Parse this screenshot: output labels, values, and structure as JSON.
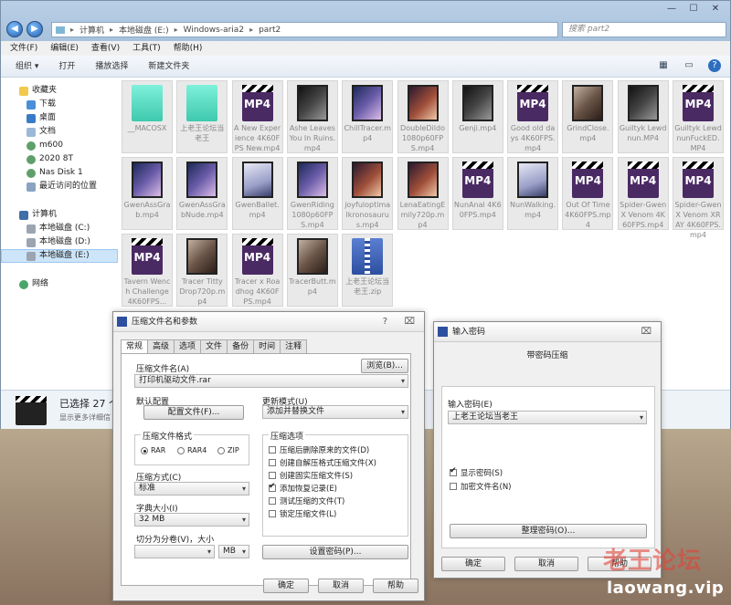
{
  "explorer": {
    "breadcrumb": [
      "计算机",
      "本地磁盘 (E:)",
      "Windows-aria2",
      "part2"
    ],
    "search_placeholder": "搜索 part2",
    "menu": [
      "文件(F)",
      "编辑(E)",
      "查看(V)",
      "工具(T)",
      "帮助(H)"
    ],
    "toolbar": [
      "组织 ▾",
      "打开",
      "播放选择",
      "新建文件夹"
    ],
    "sidebar": {
      "favorites_header": "收藏夹",
      "favorites": [
        "下载",
        "桌面",
        "文档",
        "m600",
        "2020 8T",
        "Nas Disk 1",
        "最近访问的位置"
      ],
      "computer_header": "计算机",
      "drives": [
        "本地磁盘 (C:)",
        "本地磁盘 (D:)",
        "本地磁盘 (E:)"
      ],
      "network": "网络"
    },
    "files": [
      {
        "name": "__MACOSX",
        "type": "folder"
      },
      {
        "name": "上老王论坛当老王",
        "type": "folder"
      },
      {
        "name": "A New Experience 4K60FPS New.mp4",
        "type": "mp4"
      },
      {
        "name": "Ashe Leaves You In Ruins.mp4",
        "type": "thumb",
        "v": "c"
      },
      {
        "name": "ChillTracer.mp4",
        "type": "thumb",
        "v": "b"
      },
      {
        "name": "DoubleDildo1080p60FPS.mp4",
        "type": "thumb",
        "v": "a"
      },
      {
        "name": "Genji.mp4",
        "type": "thumb",
        "v": "c"
      },
      {
        "name": "Good old days 4K60FPS.mp4",
        "type": "mp4"
      },
      {
        "name": "GrindClose.mp4",
        "type": "thumb",
        "v": "d"
      },
      {
        "name": "Guiltyk Lewd nun.MP4",
        "type": "thumb",
        "v": "c"
      },
      {
        "name": "Guiltyk Lewd nunFuckED.MP4",
        "type": "mp4"
      },
      {
        "name": "GwenAssGrab.mp4",
        "type": "thumb",
        "v": "b"
      },
      {
        "name": "GwenAssGrabNude.mp4",
        "type": "thumb",
        "v": "b"
      },
      {
        "name": "GwenBallet.mp4",
        "type": "thumb",
        "v": "e"
      },
      {
        "name": "GwenRiding1080p60FPS.mp4",
        "type": "thumb",
        "v": "b"
      },
      {
        "name": "joyfuloptimalkronosaurus.mp4",
        "type": "thumb",
        "v": "a"
      },
      {
        "name": "LenaEatingEmily720p.mp4",
        "type": "thumb",
        "v": "a"
      },
      {
        "name": "NunAnal 4K60FPS.mp4",
        "type": "mp4"
      },
      {
        "name": "NunWalking.mp4",
        "type": "thumb",
        "v": "e"
      },
      {
        "name": "Out Of Time 4K60FPS.mp4",
        "type": "mp4"
      },
      {
        "name": "Spider-Gwen X Venom 4K60FPS.mp4",
        "type": "mp4"
      },
      {
        "name": "Spider-Gwen X Venom XRAY 4K60FPS.mp4",
        "type": "mp4"
      },
      {
        "name": "Tavern Wench Challenge 4K60FPS...",
        "type": "mp4"
      },
      {
        "name": "Tracer Titty Drop720p.mp4",
        "type": "thumb",
        "v": "d"
      },
      {
        "name": "Tracer x Roadhog 4K60FPS.mp4",
        "type": "mp4"
      },
      {
        "name": "TracerButt.mp4",
        "type": "thumb",
        "v": "d"
      },
      {
        "name": "上老王论坛当老王.zip",
        "type": "zip"
      }
    ],
    "mp4_label": "MP4",
    "status_selected": "已选择 27 个",
    "status_detail": "显示更多详细信"
  },
  "archive_dialog": {
    "title": "压缩文件名和参数",
    "title_controls": [
      "?",
      "⌧"
    ],
    "tabs": [
      "常规",
      "高级",
      "选项",
      "文件",
      "备份",
      "时间",
      "注释"
    ],
    "filename_label": "压缩文件名(A)",
    "browse_button": "浏览(B)...",
    "filename_value": "打印机驱动文件.rar",
    "default_config_label": "默认配置",
    "profiles_button": "配置文件(F)...",
    "update_mode_label": "更新模式(U)",
    "update_mode_value": "添加并替换文件",
    "format_group": "压缩文件格式",
    "formats": [
      "RAR",
      "RAR4",
      "ZIP"
    ],
    "selected_format": "RAR",
    "method_label": "压缩方式(C)",
    "method_value": "标准",
    "dict_label": "字典大小(I)",
    "dict_value": "32 MB",
    "split_label": "切分为分卷(V)，大小",
    "split_value": "",
    "split_unit": "MB",
    "options_group": "压缩选项",
    "options": [
      {
        "label": "压缩后删除原来的文件(D)",
        "checked": false
      },
      {
        "label": "创建自解压格式压缩文件(X)",
        "checked": false
      },
      {
        "label": "创建固实压缩文件(S)",
        "checked": false
      },
      {
        "label": "添加恢复记录(E)",
        "checked": true
      },
      {
        "label": "测试压缩的文件(T)",
        "checked": false
      },
      {
        "label": "锁定压缩文件(L)",
        "checked": false
      }
    ],
    "set_password_button": "设置密码(P)...",
    "ok": "确定",
    "cancel": "取消",
    "help": "帮助"
  },
  "password_dialog": {
    "title": "输入密码",
    "close": "⌧",
    "heading": "带密码压缩",
    "password_label": "输入密码(E)",
    "password_value": "上老王论坛当老王",
    "show_password": "显示密码(S)",
    "show_password_checked": true,
    "encrypt_names": "加密文件名(N)",
    "encrypt_names_checked": false,
    "organize_button": "整理密码(O)...",
    "ok": "确定",
    "cancel": "取消",
    "help": "帮助"
  },
  "watermark": {
    "cn": "老王论坛",
    "url": "laowang.vip"
  }
}
